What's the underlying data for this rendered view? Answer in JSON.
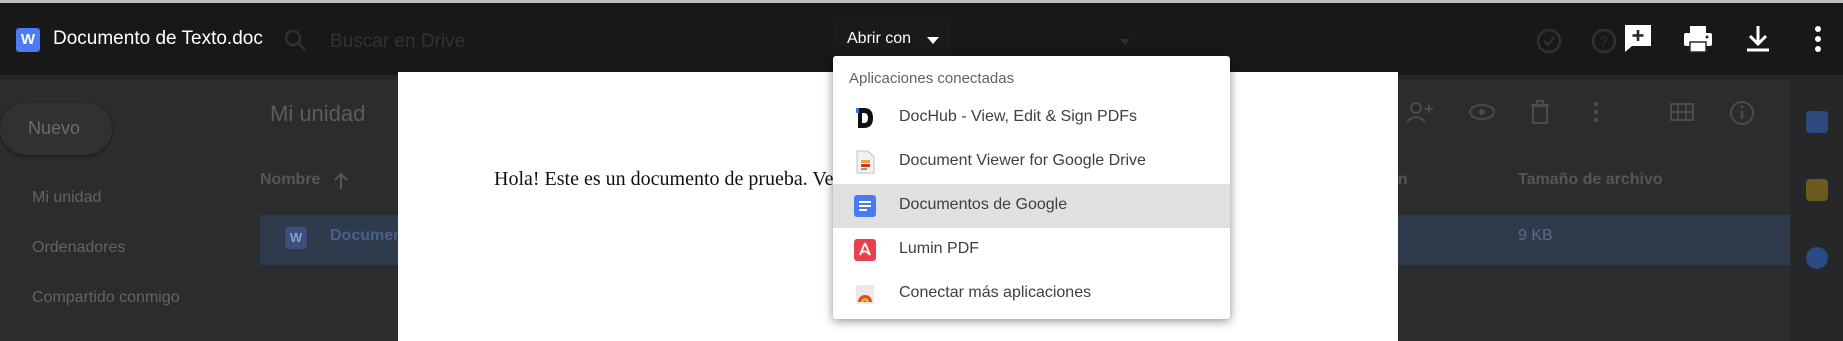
{
  "viewer": {
    "file_icon_letter": "W",
    "file_title": "Documento de Texto.doc",
    "open_with_label": "Abrir con",
    "icons": [
      "add-comment-icon",
      "print-icon",
      "download-icon",
      "more-vert-icon"
    ]
  },
  "menu": {
    "header": "Aplicaciones conectadas",
    "items": [
      {
        "label": "DocHub - View, Edit & Sign PDFs",
        "icon": "dochub-icon"
      },
      {
        "label": "Document Viewer for Google Drive",
        "icon": "document-viewer-icon"
      },
      {
        "label": "Documentos de Google",
        "icon": "google-docs-icon",
        "selected": true
      },
      {
        "label": "Lumin PDF",
        "icon": "lumin-pdf-icon"
      },
      {
        "label": "Conectar más aplicaciones",
        "icon": "connect-apps-icon"
      }
    ]
  },
  "document": {
    "text": "Hola! Este es un documento de prueba. Ve"
  },
  "drive_background": {
    "search_placeholder": "Buscar en Drive",
    "new_button": "Nuevo",
    "nav": [
      "Mi unidad",
      "Ordenadores",
      "Compartido conmigo"
    ],
    "location_title": "Mi unidad",
    "columns": {
      "name": "Nombre",
      "modified_partial": "ón",
      "size": "Tamaño de archivo"
    },
    "file": {
      "icon_letter": "W",
      "name_partial": "Documen",
      "size": "9 KB"
    }
  },
  "colors": {
    "accent": "#4a7bf2",
    "lumin": "#e8404f",
    "selected_item": "#e0e0e0"
  }
}
